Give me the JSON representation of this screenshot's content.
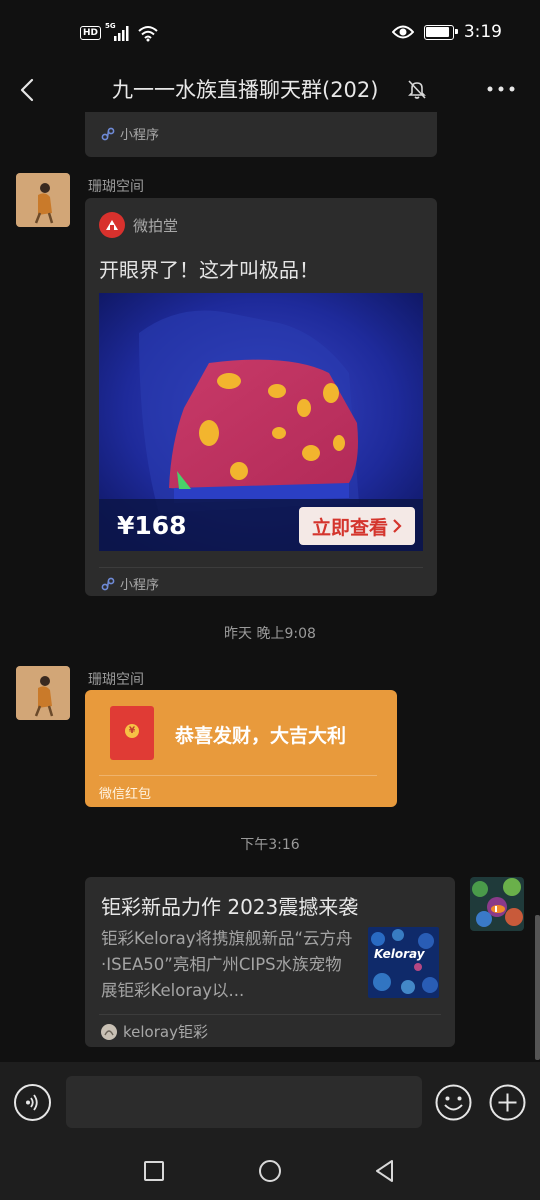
{
  "status_bar": {
    "hd": "HD",
    "network": "5G",
    "time": "3:19",
    "battery_level": 0.9
  },
  "header": {
    "title": "九一一水族直播聊天群(202)"
  },
  "messages": {
    "prev_card_footer": "小程序",
    "msg1": {
      "sender": "珊瑚空间",
      "app_name": "微拍堂",
      "title": "开眼界了！这才叫极品！",
      "price": "¥168",
      "cta": "立即查看",
      "footer": "小程序"
    },
    "timestamp1": "昨天 晚上9:08",
    "msg2": {
      "sender": "珊瑚空间",
      "greeting": "恭喜发财，大吉大利",
      "label": "微信红包"
    },
    "timestamp2": "下午3:16",
    "msg3": {
      "title": "钜彩新品力作 2023震撼来袭",
      "description": "钜彩Keloray将携旗舰新品“云方舟·ISEA50”亮相广州CIPS水族宠物展钜彩Keloray以...",
      "thumb_text": "Keloray",
      "source": "keloray钜彩"
    }
  },
  "input": {
    "value": ""
  },
  "colors": {
    "background": "#111111",
    "bubble": "#2c2c2c",
    "red_packet": "#e89a3c",
    "cta_bg": "#f4e9e6",
    "cta_text": "#d4352d"
  }
}
